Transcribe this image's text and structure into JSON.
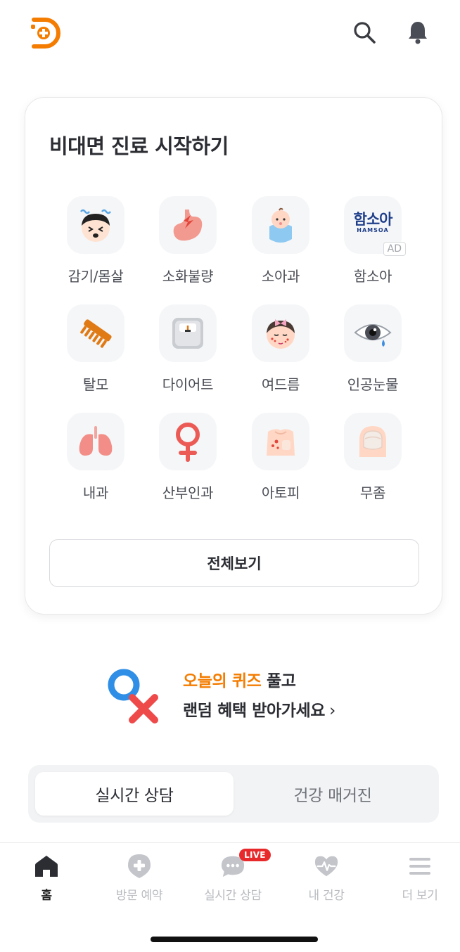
{
  "header": {
    "logo_icon": "app-logo",
    "search_icon": "search-icon",
    "bell_icon": "bell-icon"
  },
  "card": {
    "title": "비대면 진료 시작하기",
    "categories": [
      {
        "label": "감기/몸살",
        "icon": "cold-face-icon"
      },
      {
        "label": "소화불량",
        "icon": "stomach-icon"
      },
      {
        "label": "소아과",
        "icon": "baby-icon"
      },
      {
        "label": "함소아",
        "icon": "hamsoa-logo",
        "logo_text": "함소아",
        "logo_sub": "HAMSOA",
        "badge": "AD"
      },
      {
        "label": "탈모",
        "icon": "comb-icon"
      },
      {
        "label": "다이어트",
        "icon": "scale-icon"
      },
      {
        "label": "여드름",
        "icon": "acne-face-icon"
      },
      {
        "label": "인공눈물",
        "icon": "eye-drop-icon"
      },
      {
        "label": "내과",
        "icon": "lungs-icon"
      },
      {
        "label": "산부인과",
        "icon": "female-symbol-icon"
      },
      {
        "label": "아토피",
        "icon": "skin-rash-icon"
      },
      {
        "label": "무좀",
        "icon": "toenail-icon"
      }
    ],
    "view_all": "전체보기"
  },
  "quiz": {
    "highlight": "오늘의 퀴즈",
    "line1_rest": " 풀고",
    "line2": "랜덤 혜택 받아가세요",
    "chevron": "›"
  },
  "segment": {
    "active": "실시간 상담",
    "inactive": "건강 매거진"
  },
  "bottom_nav": {
    "items": [
      {
        "label": "홈",
        "icon": "home-icon",
        "active": true
      },
      {
        "label": "방문 예약",
        "icon": "hospital-plus-icon"
      },
      {
        "label": "실시간 상담",
        "icon": "chat-bubble-icon",
        "badge": "LIVE"
      },
      {
        "label": "내 건강",
        "icon": "heart-pulse-icon"
      },
      {
        "label": "더 보기",
        "icon": "menu-icon"
      }
    ]
  },
  "colors": {
    "accent": "#f47c00",
    "live": "#e8292b",
    "nav_inactive": "#b9bbc0"
  }
}
